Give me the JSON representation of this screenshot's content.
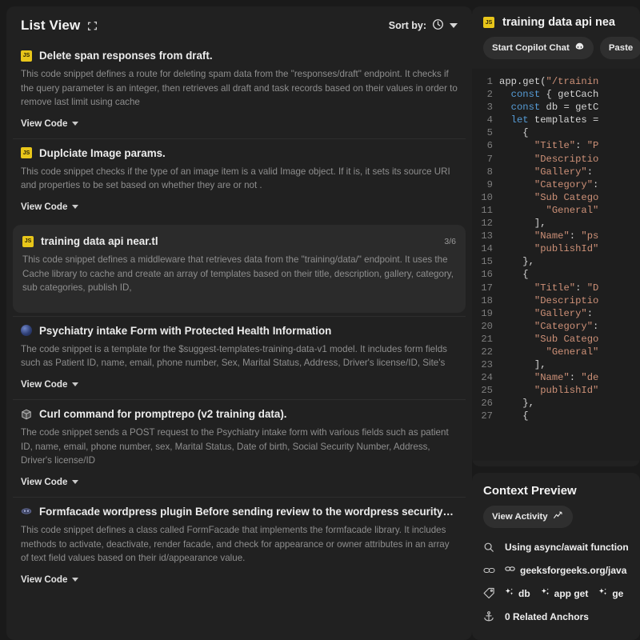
{
  "list_view": {
    "title": "List View",
    "expand_icon": "expand-icon",
    "sort_label": "Sort by:",
    "sort_icon": "clock-icon",
    "view_code_label": "View Code",
    "items": [
      {
        "icon": "js-file-icon",
        "icon_text": "JS",
        "title": "Delete span responses from draft.",
        "description": "This code snippet defines a route for deleting spam data from the \"responses/draft\" endpoint. It checks if the query parameter is an integer, then retrieves all draft and task records based on their values in order to remove last limit using cache",
        "counter": "",
        "selected": false
      },
      {
        "icon": "js-file-icon",
        "icon_text": "JS",
        "title": "Duplciate Image params.",
        "description": "This code snippet checks if the type of an image item is a valid Image object. If it is, it sets its source URI and properties to be set based on whether they are or not .",
        "counter": "",
        "selected": false
      },
      {
        "icon": "js-file-icon",
        "icon_text": "JS",
        "title": "training data api near.tl",
        "description": "This code snippet defines a middleware that retrieves data from the \"training/data/\" endpoint. It uses the Cache library to cache and create an array of templates based on their title, description, gallery, category, sub categories, publish ID,",
        "counter": "3/6",
        "selected": true
      },
      {
        "icon": "globe-icon",
        "icon_text": "",
        "title": "Psychiatry intake Form with Protected Health Information",
        "description": "The code snippet is a template for the $suggest-templates-training-data-v1 model. It includes form fields such as Patient ID, name, email, phone number, Sex, Marital Status, Address, Driver's license/ID, Site's",
        "counter": "",
        "selected": false
      },
      {
        "icon": "box-icon",
        "icon_text": "",
        "title": "Curl command for promptrepo (v2 training data).",
        "description": "The code snippet sends a POST request to the Psychiatry intake form with various fields such as patient ID, name, email, phone number, sex, Marital Status, Date of birth, Social Security Number, Address, Driver's license/ID",
        "counter": "",
        "selected": false
      },
      {
        "icon": "oval-icon",
        "icon_text": "",
        "title": "Formfacade wordpress plugin Before sending review to the wordpress security…",
        "description": "This code snippet defines a class called FormFacade that implements the formfacade library. It includes methods to activate, deactivate, render facade, and check for appearance or owner attributes in an array of text field values based on their id/appearance value.",
        "counter": "",
        "selected": false
      }
    ]
  },
  "editor": {
    "icon": "js-file-icon",
    "icon_text": "JS",
    "title": "training data api nea",
    "buttons": [
      {
        "label": "Start Copilot Chat",
        "icon": "copilot-icon"
      },
      {
        "label": "Paste",
        "icon": ""
      }
    ],
    "code_lines": [
      {
        "n": "1",
        "tokens": [
          {
            "t": "plain",
            "v": "app.get("
          },
          {
            "t": "string",
            "v": "\"/trainin"
          }
        ]
      },
      {
        "n": "2",
        "tokens": [
          {
            "t": "plain",
            "v": "  "
          },
          {
            "t": "keyword",
            "v": "const"
          },
          {
            "t": "plain",
            "v": " { getCach"
          }
        ]
      },
      {
        "n": "3",
        "tokens": [
          {
            "t": "plain",
            "v": "  "
          },
          {
            "t": "keyword",
            "v": "const"
          },
          {
            "t": "plain",
            "v": " db = getC"
          }
        ]
      },
      {
        "n": "4",
        "tokens": [
          {
            "t": "plain",
            "v": "  "
          },
          {
            "t": "keyword",
            "v": "let"
          },
          {
            "t": "plain",
            "v": " templates ="
          }
        ]
      },
      {
        "n": "5",
        "tokens": [
          {
            "t": "plain",
            "v": "    {"
          }
        ]
      },
      {
        "n": "6",
        "tokens": [
          {
            "t": "plain",
            "v": "      "
          },
          {
            "t": "string",
            "v": "\"Title\""
          },
          {
            "t": "plain",
            "v": ": "
          },
          {
            "t": "string",
            "v": "\"P"
          }
        ]
      },
      {
        "n": "7",
        "tokens": [
          {
            "t": "plain",
            "v": "      "
          },
          {
            "t": "string",
            "v": "\"Descriptio"
          }
        ]
      },
      {
        "n": "8",
        "tokens": [
          {
            "t": "plain",
            "v": "      "
          },
          {
            "t": "string",
            "v": "\"Gallery\""
          },
          {
            "t": "plain",
            "v": ":"
          }
        ]
      },
      {
        "n": "9",
        "tokens": [
          {
            "t": "plain",
            "v": "      "
          },
          {
            "t": "string",
            "v": "\"Category\""
          },
          {
            "t": "plain",
            "v": ":"
          }
        ]
      },
      {
        "n": "10",
        "tokens": [
          {
            "t": "plain",
            "v": "      "
          },
          {
            "t": "string",
            "v": "\"Sub Catego"
          }
        ]
      },
      {
        "n": "11",
        "tokens": [
          {
            "t": "plain",
            "v": "        "
          },
          {
            "t": "string",
            "v": "\"General\""
          }
        ]
      },
      {
        "n": "12",
        "tokens": [
          {
            "t": "plain",
            "v": "      ],"
          }
        ]
      },
      {
        "n": "13",
        "tokens": [
          {
            "t": "plain",
            "v": "      "
          },
          {
            "t": "string",
            "v": "\"Name\""
          },
          {
            "t": "plain",
            "v": ": "
          },
          {
            "t": "string",
            "v": "\"ps"
          }
        ]
      },
      {
        "n": "14",
        "tokens": [
          {
            "t": "plain",
            "v": "      "
          },
          {
            "t": "string",
            "v": "\"publishId\""
          }
        ]
      },
      {
        "n": "15",
        "tokens": [
          {
            "t": "plain",
            "v": "    },"
          }
        ]
      },
      {
        "n": "16",
        "tokens": [
          {
            "t": "plain",
            "v": "    {"
          }
        ]
      },
      {
        "n": "17",
        "tokens": [
          {
            "t": "plain",
            "v": "      "
          },
          {
            "t": "string",
            "v": "\"Title\""
          },
          {
            "t": "plain",
            "v": ": "
          },
          {
            "t": "string",
            "v": "\"D"
          }
        ]
      },
      {
        "n": "18",
        "tokens": [
          {
            "t": "plain",
            "v": "      "
          },
          {
            "t": "string",
            "v": "\"Descriptio"
          }
        ]
      },
      {
        "n": "19",
        "tokens": [
          {
            "t": "plain",
            "v": "      "
          },
          {
            "t": "string",
            "v": "\"Gallery\""
          },
          {
            "t": "plain",
            "v": ":"
          }
        ]
      },
      {
        "n": "20",
        "tokens": [
          {
            "t": "plain",
            "v": "      "
          },
          {
            "t": "string",
            "v": "\"Category\""
          },
          {
            "t": "plain",
            "v": ":"
          }
        ]
      },
      {
        "n": "21",
        "tokens": [
          {
            "t": "plain",
            "v": "      "
          },
          {
            "t": "string",
            "v": "\"Sub Catego"
          }
        ]
      },
      {
        "n": "22",
        "tokens": [
          {
            "t": "plain",
            "v": "        "
          },
          {
            "t": "string",
            "v": "\"General\""
          }
        ]
      },
      {
        "n": "23",
        "tokens": [
          {
            "t": "plain",
            "v": "      ],"
          }
        ]
      },
      {
        "n": "24",
        "tokens": [
          {
            "t": "plain",
            "v": "      "
          },
          {
            "t": "string",
            "v": "\"Name\""
          },
          {
            "t": "plain",
            "v": ": "
          },
          {
            "t": "string",
            "v": "\"de"
          }
        ]
      },
      {
        "n": "25",
        "tokens": [
          {
            "t": "plain",
            "v": "      "
          },
          {
            "t": "string",
            "v": "\"publishId\""
          }
        ]
      },
      {
        "n": "26",
        "tokens": [
          {
            "t": "plain",
            "v": "    },"
          }
        ]
      },
      {
        "n": "27",
        "tokens": [
          {
            "t": "plain",
            "v": "    {"
          }
        ]
      }
    ]
  },
  "context_preview": {
    "title": "Context Preview",
    "view_activity_label": "View Activity",
    "view_activity_icon": "activity-icon",
    "search_icon": "search-icon",
    "search_text": "Using async/await function",
    "link_icon": "link-icon",
    "link_text": "geeksforgeeks.org/java",
    "tag_icon": "tag-icon",
    "tags": [
      "db",
      "app get",
      "ge"
    ],
    "anchor_icon": "anchor-icon",
    "anchor_text": "0 Related Anchors"
  },
  "colors": {
    "page_bg": "#1a1a1a",
    "card_bg": "#212121",
    "selected_bg": "#2b2b2b",
    "code_bg": "#1e1e1e",
    "js_yellow": "#e8c61a",
    "keyword_blue": "#569cd6",
    "string_orange": "#ce9178"
  }
}
